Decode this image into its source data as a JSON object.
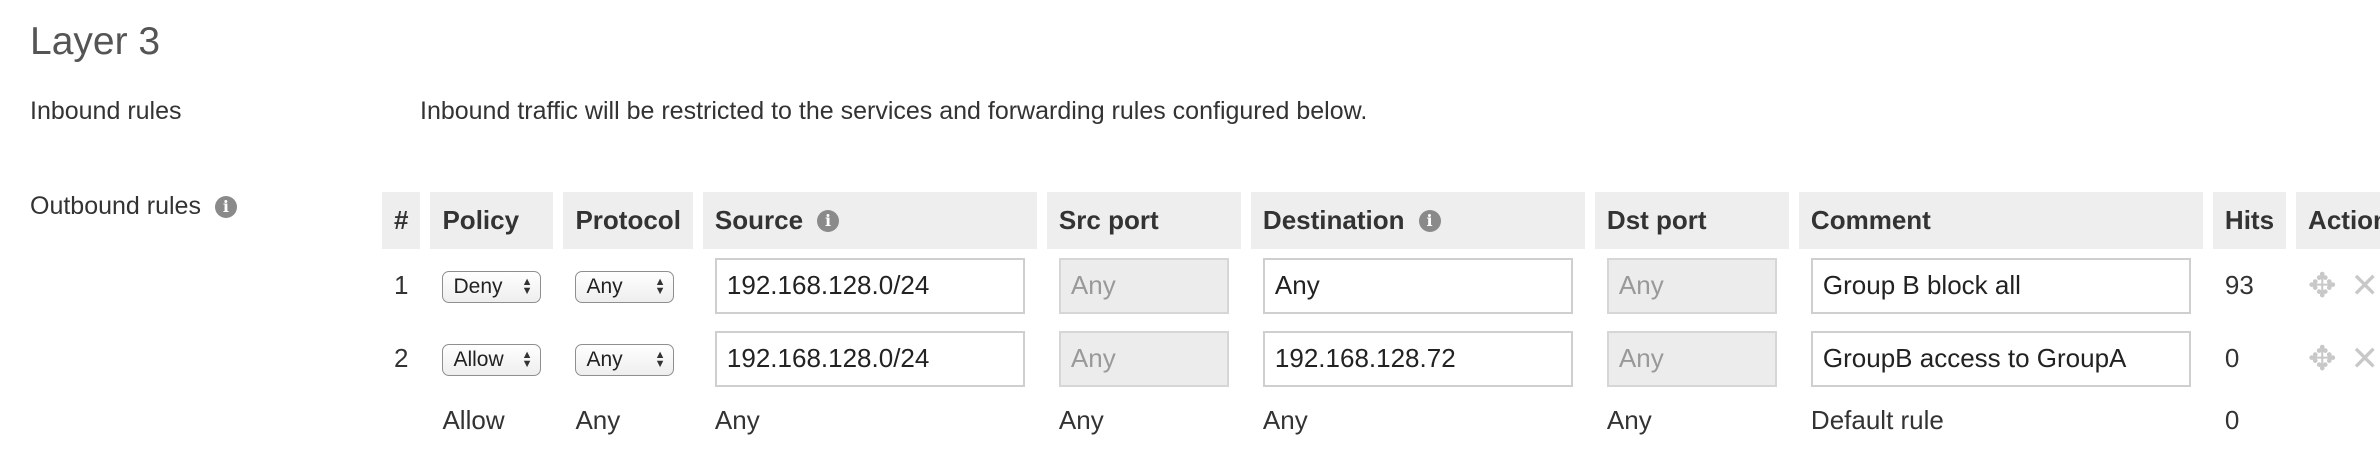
{
  "title": "Layer 3",
  "inbound": {
    "label": "Inbound rules",
    "description": "Inbound traffic will be restricted to the services and forwarding rules configured below."
  },
  "outbound": {
    "label": "Outbound rules",
    "columns": {
      "num": "#",
      "policy": "Policy",
      "protocol": "Protocol",
      "source": "Source",
      "src_port": "Src port",
      "destination": "Destination",
      "dst_port": "Dst port",
      "comment": "Comment",
      "hits": "Hits",
      "actions": "Actions"
    },
    "rows": [
      {
        "num": "1",
        "policy": "Deny",
        "protocol": "Any",
        "source": "192.168.128.0/24",
        "src_port": "Any",
        "destination": "Any",
        "dst_port": "Any",
        "comment": "Group B block all",
        "hits": "93"
      },
      {
        "num": "2",
        "policy": "Allow",
        "protocol": "Any",
        "source": "192.168.128.0/24",
        "src_port": "Any",
        "destination": "192.168.128.72",
        "dst_port": "Any",
        "comment": "GroupB access to GroupA",
        "hits": "0"
      }
    ],
    "default_rule": {
      "policy": "Allow",
      "protocol": "Any",
      "source": "Any",
      "src_port": "Any",
      "destination": "Any",
      "dst_port": "Any",
      "comment": "Default rule",
      "hits": "0"
    }
  },
  "icons": {
    "info": "info-icon",
    "move": "move-icon",
    "delete": "close-icon"
  }
}
